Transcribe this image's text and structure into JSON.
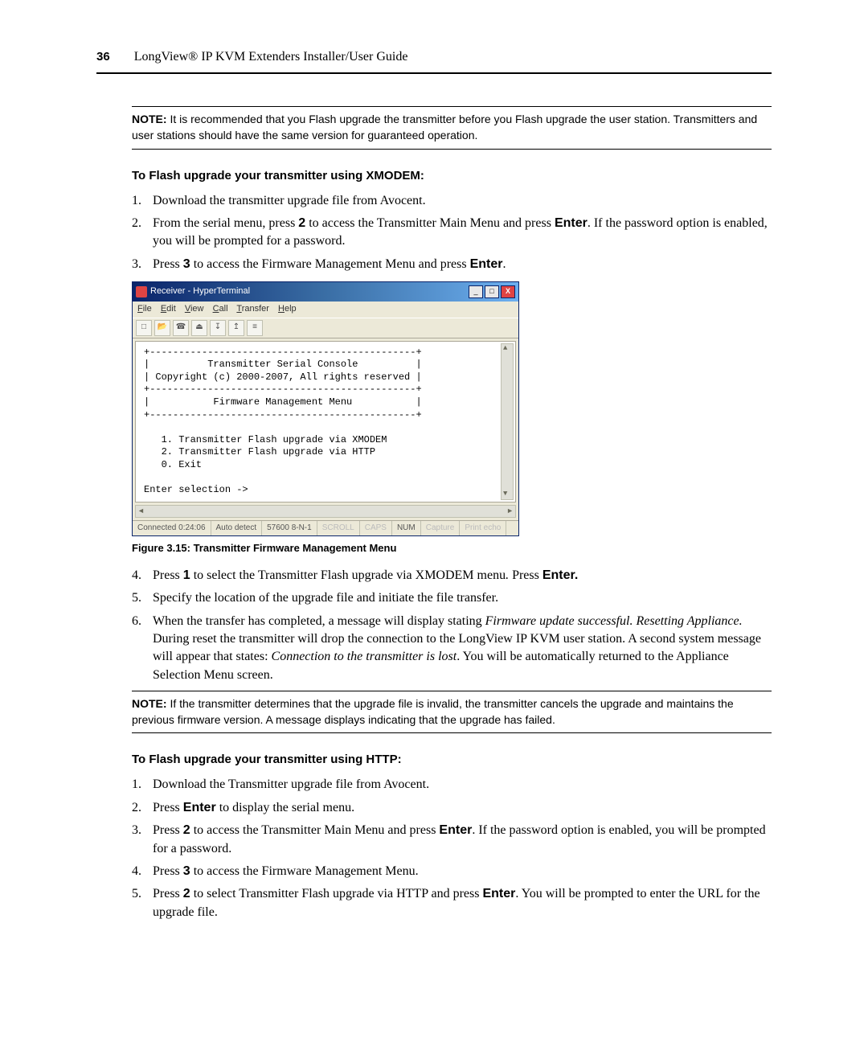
{
  "page": {
    "number": "36",
    "running_header": "LongView® IP KVM Extenders Installer/User Guide"
  },
  "note1": {
    "label": "NOTE:",
    "text": " It is recommended that you Flash upgrade the transmitter before you Flash upgrade the user station. Transmitters and user stations should have the same version for guaranteed operation."
  },
  "heading_xmodem": "To Flash upgrade your transmitter using XMODEM:",
  "xmodem_steps": {
    "s1": "Download the transmitter upgrade file from Avocent.",
    "s2a": "From the serial menu, press ",
    "s2_key1": "2",
    "s2b": " to access the Transmitter Main Menu and press ",
    "s2_key2": "Enter",
    "s2c": ". If the password option is enabled, you will be prompted for a password.",
    "s3a": "Press ",
    "s3_key1": "3",
    "s3b": " to access the Firmware Management Menu and press ",
    "s3_key2": "Enter",
    "s3c": ".",
    "s4a": "Press ",
    "s4_key1": "1",
    "s4b": " to select the Transmitter Flash upgrade via XMODEM menu",
    "s4_period": ".",
    "s4c": " Press ",
    "s4_key2": "Enter.",
    "s5": "Specify the location of the upgrade file and initiate the file transfer.",
    "s6a": "When the transfer has completed, a message will display stating ",
    "s6_italic1": "Firmware update successful. Resetting Appliance.",
    "s6b": " During reset the transmitter will drop the connection to the LongView IP KVM user station. A second system message will appear that states: ",
    "s6_italic2": "Connection to the transmitter is lost",
    "s6c": ". You will be automatically returned to the Appliance Selection Menu screen."
  },
  "figure_caption": "Figure 3.15: Transmitter Firmware Management Menu",
  "hyperterminal": {
    "title": "Receiver - HyperTerminal",
    "menu": [
      "File",
      "Edit",
      "View",
      "Call",
      "Transfer",
      "Help"
    ],
    "term_lines": "+----------------------------------------------+\n|          Transmitter Serial Console          |\n| Copyright (c) 2000-2007, All rights reserved |\n+----------------------------------------------+\n|           Firmware Management Menu           |\n+----------------------------------------------+\n\n   1. Transmitter Flash upgrade via XMODEM\n   2. Transmitter Flash upgrade via HTTP\n   0. Exit\n\nEnter selection ->",
    "status": {
      "connected": "Connected 0:24:06",
      "detect": "Auto detect",
      "baud": "57600 8-N-1",
      "scroll": "SCROLL",
      "caps": "CAPS",
      "num": "NUM",
      "capture": "Capture",
      "print": "Print echo"
    }
  },
  "note2": {
    "label": "NOTE:",
    "text": " If the transmitter determines that the upgrade file is invalid, the transmitter cancels the upgrade and maintains the previous firmware version. A message displays indicating that the upgrade has failed."
  },
  "heading_http": "To Flash upgrade your transmitter using HTTP:",
  "http_steps": {
    "s1": "Download the Transmitter upgrade file from Avocent.",
    "s2a": "Press ",
    "s2_key1": "Enter",
    "s2b": " to display the serial menu.",
    "s3a": "Press ",
    "s3_key1": "2",
    "s3b": " to access the Transmitter Main Menu and press ",
    "s3_key2": "Enter",
    "s3c": ". If the password option is enabled, you will be prompted for a password.",
    "s4a": "Press ",
    "s4_key1": "3",
    "s4b": " to access the Firmware Management Menu.",
    "s5a": "Press ",
    "s5_key1": "2",
    "s5b": " to select Transmitter Flash upgrade via HTTP and press ",
    "s5_key2": "Enter",
    "s5c": ". You will be prompted to enter the URL for the upgrade file."
  }
}
